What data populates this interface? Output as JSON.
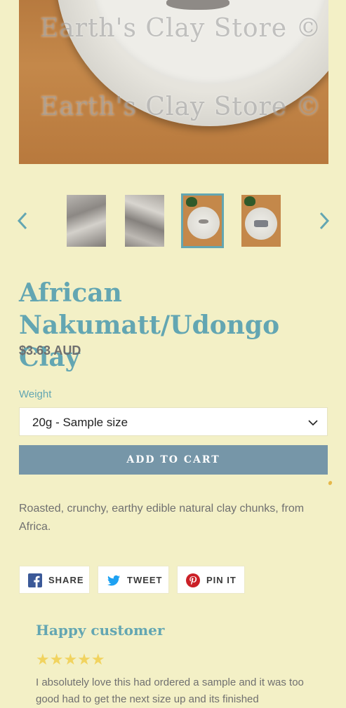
{
  "hero": {
    "watermark": "Earth's Clay Store ©"
  },
  "gallery": {
    "thumb_count": 4,
    "active_index": 2
  },
  "product": {
    "title": "African Nakumatt/Udongo Clay",
    "price": "$3.63 AUD",
    "weight_label": "Weight",
    "weight_selected": "20g - Sample size",
    "add_to_cart": "ADD TO CART",
    "description": "Roasted, crunchy, earthy edible natural clay chunks, from Africa."
  },
  "share": {
    "facebook": "SHARE",
    "twitter": "TWEET",
    "pinterest": "PIN IT"
  },
  "review": {
    "title": "Happy customer",
    "stars": "★★★★★",
    "rating": 5,
    "text": "I absolutely love this had ordered a sample and it was too good had to get the next size up and its finished"
  },
  "colors": {
    "background": "#f3f0c6",
    "accent": "#63a6b2",
    "button": "#7696a8",
    "star": "#f1d35f"
  }
}
